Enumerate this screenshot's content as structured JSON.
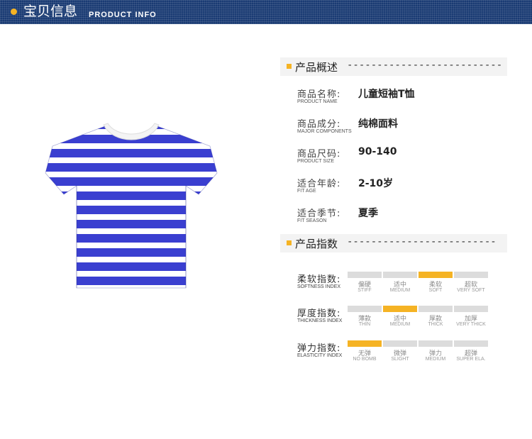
{
  "header": {
    "title": "宝贝信息",
    "subtitle": "PRODUCT INFO",
    "accent": "#f5b324",
    "background": "#1a3b73"
  },
  "overview": {
    "title": "产品概述",
    "dashes": "--------------------------",
    "rows": [
      {
        "label": "商品名称:",
        "label_en": "PRODUCT NAME",
        "value": "儿童短袖T恤"
      },
      {
        "label": "商品成分:",
        "label_en": "MAJOR COMPONENTS",
        "value": "纯棉面料"
      },
      {
        "label": "商品尺码:",
        "label_en": "PRODUCT SIZE",
        "value": "90-140"
      },
      {
        "label": "适合年龄:",
        "label_en": "FIT AGE",
        "value": "2-10岁"
      },
      {
        "label": "适合季节:",
        "label_en": "FIT SEASON",
        "value": "夏季"
      }
    ]
  },
  "indices": {
    "title": "产品指数",
    "dashes": "-------------------------",
    "rows": [
      {
        "label": "柔软指数:",
        "label_en": "SOFTNESS INDEX",
        "selected": 2,
        "options": [
          {
            "cn": "偏硬",
            "en": "STIFF"
          },
          {
            "cn": "适中",
            "en": "MEDIUM"
          },
          {
            "cn": "柔软",
            "en": "SOFT"
          },
          {
            "cn": "超软",
            "en": "VERY SOFT"
          }
        ]
      },
      {
        "label": "厚度指数:",
        "label_en": "THICKNESS INDEX",
        "selected": 1,
        "options": [
          {
            "cn": "薄款",
            "en": "THIN"
          },
          {
            "cn": "适中",
            "en": "MEDIUM"
          },
          {
            "cn": "厚款",
            "en": "THICK"
          },
          {
            "cn": "加厚",
            "en": "VERY THICK"
          }
        ]
      },
      {
        "label": "弹力指数:",
        "label_en": "ELASTICITY INDEX",
        "selected": 0,
        "options": [
          {
            "cn": "无弹",
            "en": "NO BOMB"
          },
          {
            "cn": "微弹",
            "en": "SLIGHT"
          },
          {
            "cn": "弹力",
            "en": "MEDIUM"
          },
          {
            "cn": "超弹",
            "en": "SUPER ELA."
          }
        ]
      }
    ]
  },
  "product_image": {
    "icon": "striped-tshirt",
    "stripe_color": "#3a3fd0",
    "base_color": "#ffffff"
  }
}
